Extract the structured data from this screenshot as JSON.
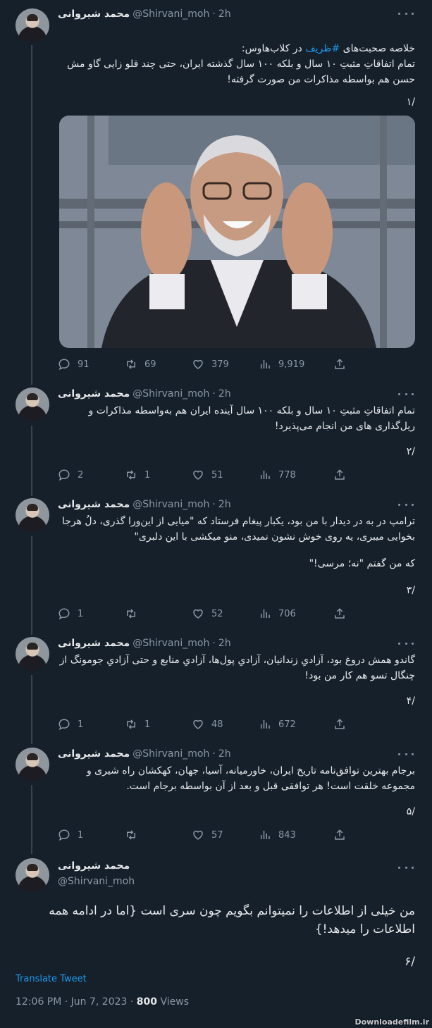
{
  "tweets": [
    {
      "name": "محمد شیروانی",
      "handle": "@Shirvani_moh",
      "time": "2h",
      "text_before_tag": "خلاصه صحبت‌های ",
      "hashtag": "#ظریف",
      "text_after_tag": " در کلاب‌هاوس:",
      "body": "تمام اتفاقاتِ مثبتِ ۱۰ سال و بلکه ۱۰۰ سال گذشته ایران، حتی چند قلو زایی گاو مش حسن هم بواسطه مذاکرات من صورت گرفته!",
      "number": "/۱",
      "stats": {
        "replies": "91",
        "retweets": "69",
        "likes": "379",
        "views": "9,919"
      }
    },
    {
      "name": "محمد شیروانی",
      "handle": "@Shirvani_moh",
      "time": "2h",
      "body": "تمام اتفاقاتِ مثبتِ ۱۰ سال و بلکه ۱۰۰ سال آینده ایران هم به‌واسطه مذاکرات و ریل‌گذاری های من انجام می‌پذیرد!",
      "number": "/۲",
      "stats": {
        "replies": "2",
        "retweets": "1",
        "likes": "51",
        "views": "778"
      }
    },
    {
      "name": "محمد شیروانی",
      "handle": "@Shirvani_moh",
      "time": "2h",
      "body": "ترامپ در به در دیدار با من بود، یکبار پیغام فرستاد که \"میایی از این‌ورا گذری، دلُ هرجا بخوایی میبری، یه روی خوش نشون نمیدی، منو میکشی با این دلبری\"",
      "body2": "که من گفتم \"نه؛ مرسی!\"",
      "number": "/۳",
      "stats": {
        "replies": "1",
        "retweets": "",
        "likes": "52",
        "views": "706"
      }
    },
    {
      "name": "محمد شیروانی",
      "handle": "@Shirvani_moh",
      "time": "2h",
      "body": "گاندو همش دروغ بود، آزادیِ زندانیان، آزادیِ پول‌ها، آزادیِ منابع و حتی آزادیِ جومونگ از چنگال تسو هم کار من بود!",
      "number": "/۴",
      "stats": {
        "replies": "1",
        "retweets": "1",
        "likes": "48",
        "views": "672"
      }
    },
    {
      "name": "محمد شیروانی",
      "handle": "@Shirvani_moh",
      "time": "2h",
      "body": "برجام بهترین توافق‌نامه تاریخ ایران، خاورمیانه، آسیا، جهان، کهکشان راه شیری و مجموعه خلقت است! هر توافقی قبل و بعد از آن بواسطه برجام است.",
      "number": "/۵",
      "stats": {
        "replies": "1",
        "retweets": "",
        "likes": "57",
        "views": "843"
      }
    }
  ],
  "main_tweet": {
    "name": "محمد شیروانی",
    "handle": "@Shirvani_moh",
    "body": "من خیلی از اطلاعات را نمیتوانم بگویم چون سری است {اما در ادامه همه اطلاعات را میدهد!}",
    "number": "/۶",
    "translate": "Translate Tweet",
    "timestamp": "12:06 PM · Jun 7, 2023 · ",
    "views_count": "800",
    "views_label": " Views"
  },
  "watermark": "Downloadefilm.ir",
  "colors": {
    "background": "#15202b",
    "accent": "#1d9bf0",
    "muted": "#8b98a5",
    "line": "#38444d"
  }
}
